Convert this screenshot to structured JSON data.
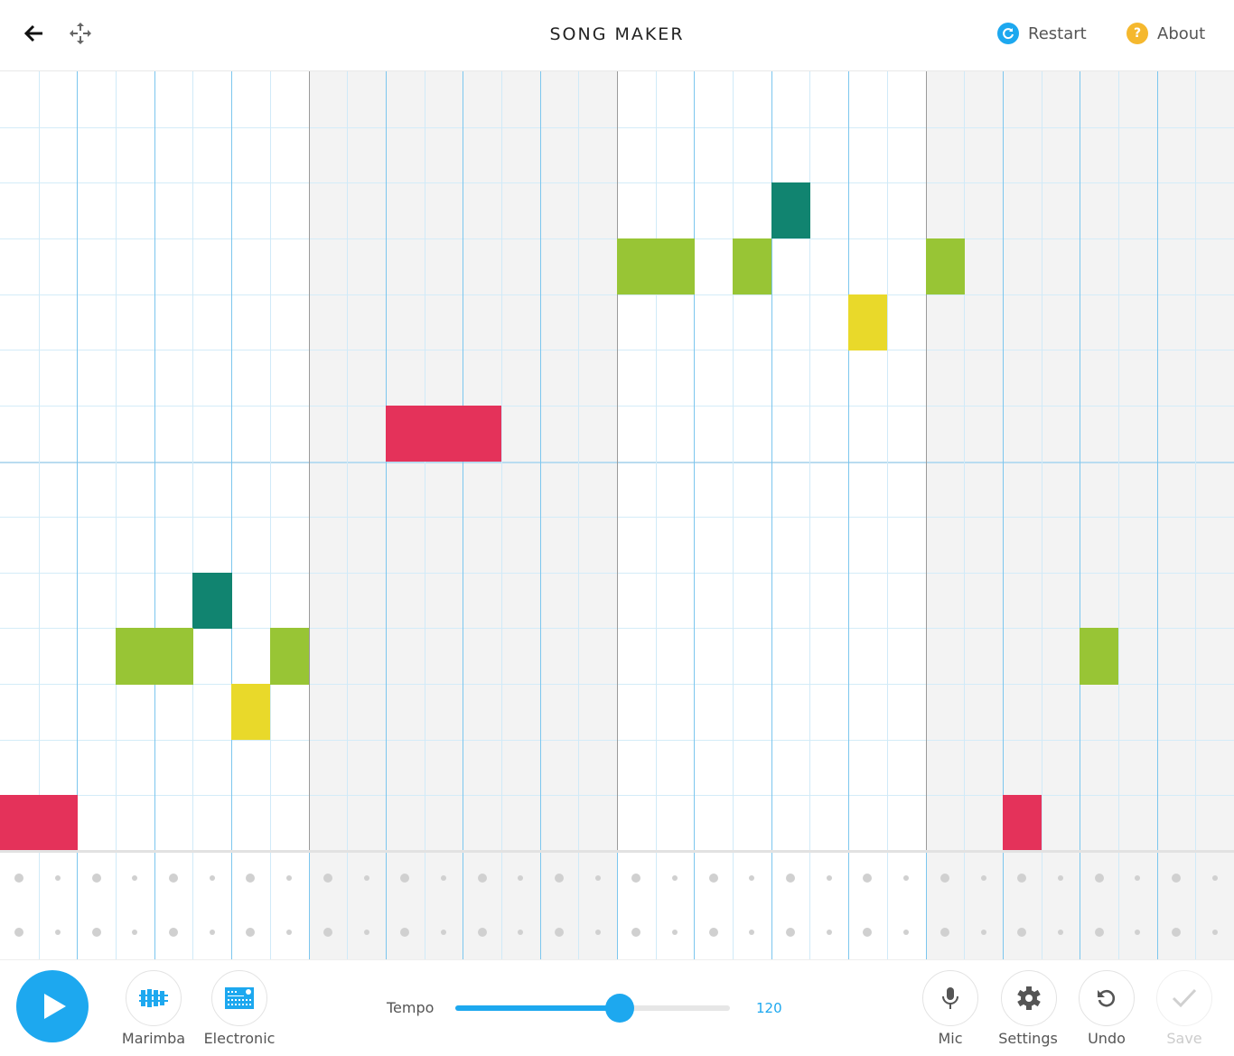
{
  "header": {
    "title": "SONG MAKER",
    "restart_label": "Restart",
    "about_label": "About",
    "about_glyph": "?",
    "back_icon": "arrow-left-icon",
    "move_icon": "move-arrows-icon"
  },
  "grid": {
    "columns": 32,
    "beats_per_bar": 8,
    "melody_rows": 14,
    "percussion_rows": 2,
    "note_colors": {
      "red": "#e4325a",
      "green": "#98c535",
      "teal": "#118470",
      "yellow": "#e9d92a"
    },
    "notes": [
      {
        "col": 20,
        "row": 2,
        "color": "teal"
      },
      {
        "col": 16,
        "row": 3,
        "color": "green"
      },
      {
        "col": 17,
        "row": 3,
        "color": "green"
      },
      {
        "col": 19,
        "row": 3,
        "color": "green"
      },
      {
        "col": 24,
        "row": 3,
        "color": "green"
      },
      {
        "col": 22,
        "row": 4,
        "color": "yellow"
      },
      {
        "col": 10,
        "row": 6,
        "color": "red"
      },
      {
        "col": 11,
        "row": 6,
        "color": "red"
      },
      {
        "col": 12,
        "row": 6,
        "color": "red"
      },
      {
        "col": 5,
        "row": 9,
        "color": "teal"
      },
      {
        "col": 3,
        "row": 10,
        "color": "green"
      },
      {
        "col": 4,
        "row": 10,
        "color": "green"
      },
      {
        "col": 7,
        "row": 10,
        "color": "green"
      },
      {
        "col": 28,
        "row": 10,
        "color": "green"
      },
      {
        "col": 6,
        "row": 11,
        "color": "yellow"
      },
      {
        "col": 0,
        "row": 13,
        "color": "red"
      },
      {
        "col": 1,
        "row": 13,
        "color": "red"
      },
      {
        "col": 26,
        "row": 13,
        "color": "red"
      }
    ]
  },
  "footer": {
    "play_icon": "play-icon",
    "instruments": [
      {
        "label": "Marimba",
        "icon": "marimba-icon"
      },
      {
        "label": "Electronic",
        "icon": "drum-machine-icon"
      }
    ],
    "tempo": {
      "label": "Tempo",
      "value": "120",
      "fraction": 0.6
    },
    "actions": [
      {
        "label": "Mic",
        "icon": "mic-icon"
      },
      {
        "label": "Settings",
        "icon": "gear-icon"
      },
      {
        "label": "Undo",
        "icon": "undo-icon"
      },
      {
        "label": "Save",
        "icon": "check-icon",
        "disabled": true
      }
    ],
    "accent": "#1da8ef"
  }
}
